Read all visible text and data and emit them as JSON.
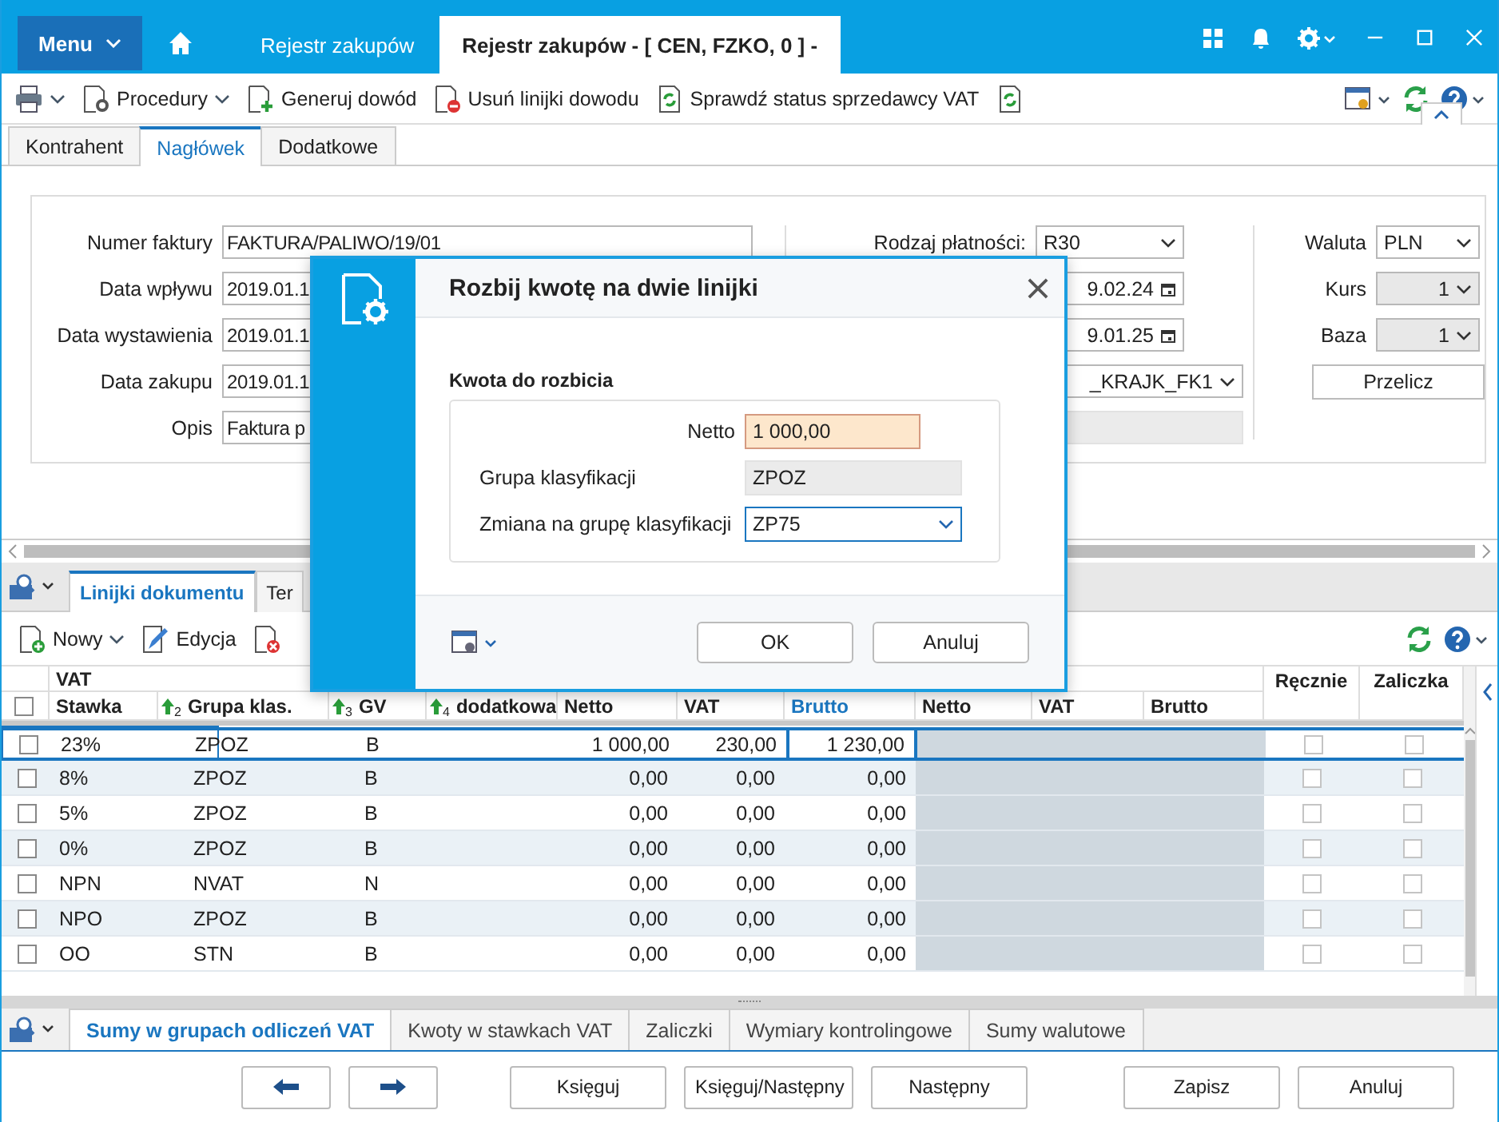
{
  "title_bar": {
    "menu": "Menu",
    "tabs": [
      {
        "label": "Rejestr zakupów",
        "selected": false
      },
      {
        "label": "Rejestr zakupów - [ CEN, FZKO, 0 ] -",
        "selected": true
      }
    ]
  },
  "toolbar": {
    "items": [
      {
        "kind": "print",
        "dropdown": true
      },
      {
        "kind": "procedure",
        "label": "Procedury",
        "dropdown": true
      },
      {
        "kind": "generate",
        "label": "Generuj dowód",
        "dropdown": false
      },
      {
        "kind": "remove",
        "label": "Usuń linijki dowodu",
        "dropdown": false
      },
      {
        "kind": "check",
        "label": "Sprawdź status sprzedawcy VAT",
        "dropdown": false
      },
      {
        "kind": "refresh-doc",
        "dropdown": false
      }
    ]
  },
  "form_tabs": [
    {
      "label": "Kontrahent",
      "selected": false
    },
    {
      "label": "Nagłówek",
      "selected": true
    },
    {
      "label": "Dodatkowe",
      "selected": false
    }
  ],
  "form": {
    "left": [
      {
        "label": "Numer faktury",
        "value": "FAKTURA/PALIWO/19/01"
      },
      {
        "label": "Data wpływu",
        "value": "2019.01.1"
      },
      {
        "label": "Data wystawienia",
        "value": "2019.01.1"
      },
      {
        "label": "Data zakupu",
        "value": "2019.01.1"
      },
      {
        "label": "Opis",
        "value": "Faktura p"
      }
    ],
    "middle": [
      {
        "label": "Rodzaj płatności:",
        "value": "R30",
        "kind": "select"
      },
      {
        "value": "9.02.24",
        "kind": "date"
      },
      {
        "value": "9.01.25",
        "kind": "date"
      },
      {
        "value": "_KRAJK_FK1",
        "kind": "select"
      },
      {
        "kind": "readonly"
      }
    ],
    "right": [
      {
        "label": "Waluta",
        "value": "PLN",
        "disabled": false
      },
      {
        "label": "Kurs",
        "value": "1",
        "disabled": true
      },
      {
        "label": "Baza",
        "value": "1",
        "disabled": true
      }
    ],
    "button": "Przelicz"
  },
  "lines_tabs": [
    {
      "label": "Linijki dokumentu",
      "selected": true
    },
    {
      "label": "Ter",
      "selected": false
    }
  ],
  "lines_toolbar": [
    {
      "kind": "new",
      "label": "Nowy",
      "dropdown": true
    },
    {
      "kind": "edit",
      "label": "Edycja",
      "dropdown": false
    },
    {
      "kind": "delete",
      "dropdown": false
    }
  ],
  "table": {
    "group": "VAT",
    "all_checked": false,
    "columns": [
      {
        "label": "Stawka",
        "active": false
      },
      {
        "label": "Grupa klas.",
        "sort": "2",
        "active": false
      },
      {
        "label": "GV",
        "sort": "3",
        "active": false
      },
      {
        "label": "dodatkowa",
        "sort": "4",
        "active": false
      },
      {
        "label": "Netto",
        "active": false
      },
      {
        "label": "VAT",
        "active": false
      },
      {
        "label": "Brutto",
        "active": true
      },
      {
        "label": "Netto",
        "active": false
      },
      {
        "label": "VAT",
        "active": false
      },
      {
        "label": "Brutto",
        "active": false
      },
      {
        "label": "Ręcznie",
        "active": false
      },
      {
        "label": "Zaliczka",
        "active": false
      }
    ],
    "rows": [
      {
        "selected": true,
        "checked": false,
        "manual": false,
        "advance": false,
        "rate": "23%",
        "group": "ZPOZ",
        "gv": "B",
        "net": "1 000,00",
        "vat": "230,00",
        "gross": "1 230,00"
      },
      {
        "selected": false,
        "checked": false,
        "manual": false,
        "advance": false,
        "rate": "8%",
        "group": "ZPOZ",
        "gv": "B",
        "net": "0,00",
        "vat": "0,00",
        "gross": "0,00"
      },
      {
        "selected": false,
        "checked": false,
        "manual": false,
        "advance": false,
        "rate": "5%",
        "group": "ZPOZ",
        "gv": "B",
        "net": "0,00",
        "vat": "0,00",
        "gross": "0,00"
      },
      {
        "selected": false,
        "checked": false,
        "manual": false,
        "advance": false,
        "rate": "0%",
        "group": "ZPOZ",
        "gv": "B",
        "net": "0,00",
        "vat": "0,00",
        "gross": "0,00"
      },
      {
        "selected": false,
        "checked": false,
        "manual": false,
        "advance": false,
        "rate": "NPN",
        "group": "NVAT",
        "gv": "N",
        "net": "0,00",
        "vat": "0,00",
        "gross": "0,00"
      },
      {
        "selected": false,
        "checked": false,
        "manual": false,
        "advance": false,
        "rate": "NPO",
        "group": "ZPOZ",
        "gv": "B",
        "net": "0,00",
        "vat": "0,00",
        "gross": "0,00"
      },
      {
        "selected": false,
        "checked": false,
        "manual": false,
        "advance": false,
        "rate": "OO",
        "group": "STN",
        "gv": "B",
        "net": "0,00",
        "vat": "0,00",
        "gross": "0,00"
      }
    ]
  },
  "bottom_tabs": [
    {
      "label": "Sumy w grupach odliczeń VAT",
      "selected": true
    },
    {
      "label": "Kwoty w stawkach VAT",
      "selected": false
    },
    {
      "label": "Zaliczki",
      "selected": false
    },
    {
      "label": "Wymiary kontrolingowe",
      "selected": false
    },
    {
      "label": "Sumy walutowe",
      "selected": false
    }
  ],
  "buttons": [
    {
      "kind": "back"
    },
    {
      "kind": "forward"
    },
    {
      "kind": "text",
      "label": "Księguj"
    },
    {
      "kind": "text",
      "label": "Księguj/Następny"
    },
    {
      "kind": "text",
      "label": "Następny"
    },
    {
      "kind": "text",
      "label": "Zapisz"
    },
    {
      "kind": "text",
      "label": "Anuluj"
    }
  ],
  "dialog": {
    "title": "Rozbij kwotę na dwie linijki",
    "section": "Kwota do rozbicia",
    "fields": [
      {
        "kind": "input",
        "label": "Netto",
        "value": "1 000,00"
      },
      {
        "kind": "readonly",
        "label": "Grupa klasyfikacji",
        "value": "ZPOZ"
      },
      {
        "kind": "select",
        "label": "Zmiana na grupę klasyfikacji",
        "value": "ZP75"
      }
    ],
    "buttons": [
      "OK",
      "Anuluj"
    ]
  }
}
